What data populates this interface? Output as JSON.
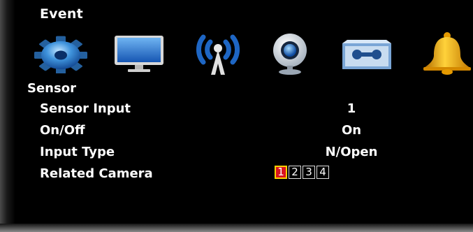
{
  "menu": {
    "title": "Event"
  },
  "icons": [
    {
      "name": "gear-icon",
      "color": "#3d8fd6"
    },
    {
      "name": "monitor-icon",
      "color": "#2a7fd0"
    },
    {
      "name": "wireless-icon",
      "color": "#1e6fc8"
    },
    {
      "name": "webcam-icon",
      "color": "#5aa7e8"
    },
    {
      "name": "cassette-icon",
      "color": "#7ab3e6"
    },
    {
      "name": "bell-icon",
      "color": "#f3a200"
    }
  ],
  "section": {
    "title": "Sensor"
  },
  "settings": {
    "sensor_input": {
      "label": "Sensor Input",
      "value": "1"
    },
    "on_off": {
      "label": "On/Off",
      "value": "On"
    },
    "input_type": {
      "label": "Input Type",
      "value": "N/Open"
    },
    "related_camera": {
      "label": "Related Camera",
      "cameras": [
        "1",
        "2",
        "3",
        "4"
      ],
      "selected": "1"
    }
  },
  "colors": {
    "background": "#000000",
    "text": "#ffffff",
    "selected_fill": "#d8131f",
    "selected_border": "#ffd300"
  }
}
